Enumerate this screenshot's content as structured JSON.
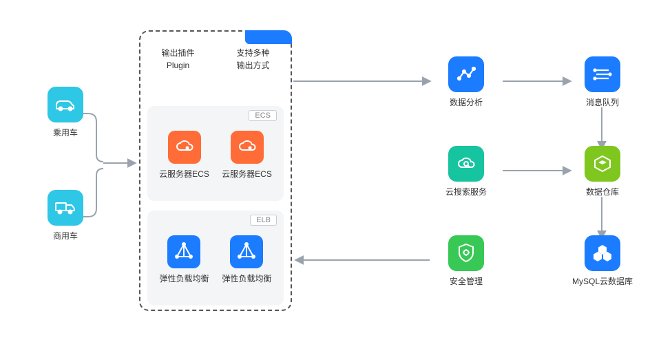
{
  "left": {
    "car": {
      "label": "乘用车"
    },
    "truck": {
      "label": "商用车"
    }
  },
  "center": {
    "tab": "",
    "top": {
      "left": {
        "line1": "输出插件",
        "line2": "Plugin"
      },
      "right": {
        "line1": "支持多种",
        "line2": "输出方式"
      }
    },
    "ecs": {
      "tag": "ECS",
      "item1": "云服务器ECS",
      "item2": "云服务器ECS"
    },
    "elb": {
      "tag": "ELB",
      "item1": "弹性负载均衡",
      "item2": "弹性负载均衡"
    }
  },
  "right": {
    "analytics": {
      "label": "数据分析"
    },
    "mq": {
      "label": "消息队列"
    },
    "search": {
      "label": "云搜索服务"
    },
    "warehouse": {
      "label": "数据仓库"
    },
    "security": {
      "label": "安全管理"
    },
    "mysql": {
      "label": "MySQL云数据库"
    }
  },
  "colors": {
    "cyan": "#2ec7e5",
    "blue": "#1b7cff",
    "teal": "#17c4a0",
    "green": "#38c856",
    "lime": "#7fc71f",
    "orange": "#ff6c37",
    "arrow": "#9aa3ad"
  }
}
